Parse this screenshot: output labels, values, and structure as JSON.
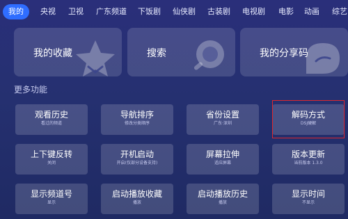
{
  "nav": {
    "tabs": [
      "我的",
      "央视",
      "卫视",
      "广东频道",
      "下饭剧",
      "仙侠剧",
      "古装剧",
      "电视剧",
      "电影",
      "动画",
      "综艺"
    ],
    "active_index": 0
  },
  "main_cards": [
    {
      "label": "我的收藏",
      "icon": "star-icon"
    },
    {
      "label": "搜索",
      "icon": "search-icon"
    },
    {
      "label": "我的分享码",
      "icon": "share-icon"
    }
  ],
  "section_title": "更多功能",
  "functions": [
    {
      "title": "观看历史",
      "subtitle": "看过的频道"
    },
    {
      "title": "导航排序",
      "subtitle": "修改分类顺序"
    },
    {
      "title": "省份设置",
      "subtitle": "广东·深圳"
    },
    {
      "title": "解码方式",
      "subtitle": "DSJ硬解"
    },
    {
      "title": "上下键反转",
      "subtitle": "关闭"
    },
    {
      "title": "开机启动",
      "subtitle": "开启(仅部分设备支持)"
    },
    {
      "title": "屏幕拉伸",
      "subtitle": "适应屏幕"
    },
    {
      "title": "版本更新",
      "subtitle": "当前版本 1.3.0"
    },
    {
      "title": "显示频道号",
      "subtitle": "显示"
    },
    {
      "title": "启动播放收藏",
      "subtitle": "播放"
    },
    {
      "title": "启动播放历史",
      "subtitle": "播放"
    },
    {
      "title": "显示时间",
      "subtitle": "不显示"
    }
  ],
  "colors": {
    "accent": "#2f6dff",
    "highlight": "#e0282d"
  }
}
